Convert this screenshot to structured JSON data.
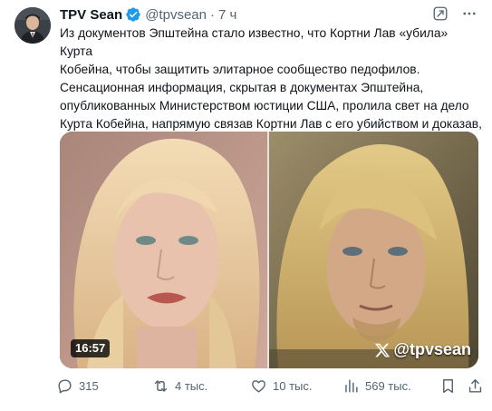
{
  "tweet": {
    "author_name": "TPV Sean",
    "handle": "@tpvsean",
    "separator": "·",
    "time": "7 ч",
    "text": "Из документов Эпштейна стало известно, что Кортни Лав «убила» Курта\nКобейна, чтобы защитить элитарное сообщество педофилов.\nСенсационная информация, скрытая в документах Эпштейна,\nопубликованных Министерством юстиции США, пролила свет на дело\nКурта Кобейна, напрямую связав Кортни Лав с его убийством и доказав,\nчто целое поколение было обмануто в космических масштабах."
  },
  "media": {
    "duration": "16:57",
    "watermark": "@tpvsean"
  },
  "actions": {
    "replies": "315",
    "retweets": "4 тыс.",
    "likes": "10 тыс.",
    "views": "569 тыс."
  },
  "colors": {
    "text": "#0f1419",
    "secondary": "#536471",
    "verified": "#1d9bf0"
  }
}
